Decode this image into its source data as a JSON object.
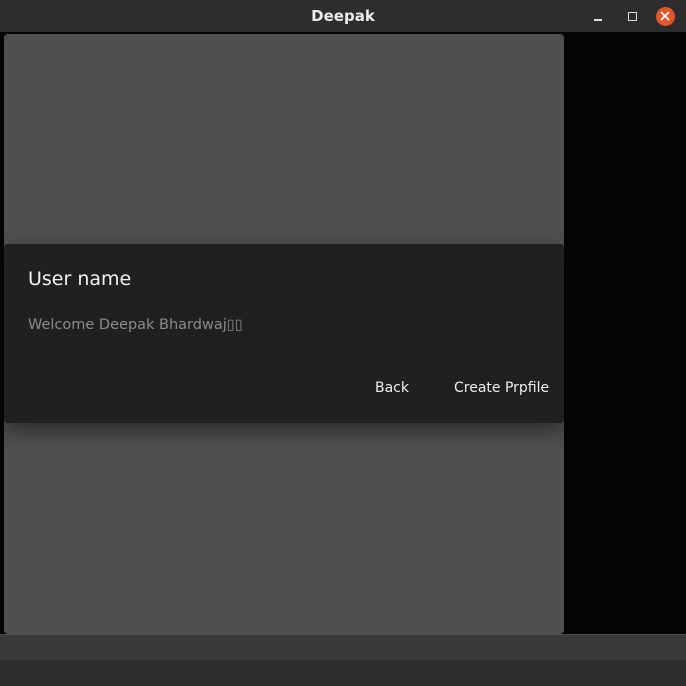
{
  "window": {
    "title": "Deepak",
    "controls": {
      "minimize_icon": "minimize-icon",
      "maximize_icon": "maximize-icon",
      "close_icon": "close-icon",
      "close_color": "#e2562a"
    }
  },
  "dialog": {
    "title": "User name",
    "message": "Welcome Deepak Bhardwaj▯▯",
    "buttons": {
      "back": "Back",
      "create_profile": "Create Prpfile"
    }
  },
  "colors": {
    "titlebar": "#2d2d2d",
    "phone_background": "#4f4f4f",
    "dialog_background": "#202020",
    "message_text": "#8b8b8b"
  }
}
